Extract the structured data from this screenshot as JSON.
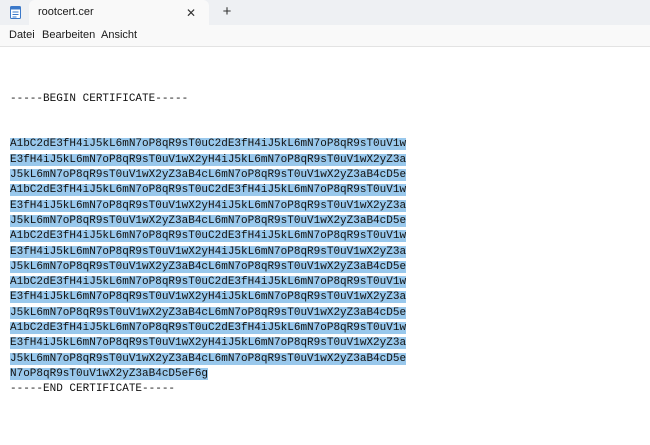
{
  "window": {
    "tab_title": "rootcert.cer",
    "close_glyph": "✕",
    "new_tab_glyph": "+"
  },
  "menu": {
    "file": "Datei",
    "edit": "Bearbeiten",
    "view": "Ansicht"
  },
  "document": {
    "begin_line": "-----BEGIN CERTIFICATE-----",
    "body_lines": [
      "A1bC2dE3fH4iJ5kL6mN7oP8qR9sT0uC2dE3fH4iJ5kL6mN7oP8qR9sT0uV1w",
      "E3fH4iJ5kL6mN7oP8qR9sT0uV1wX2yH4iJ5kL6mN7oP8qR9sT0uV1wX2yZ3a",
      "J5kL6mN7oP8qR9sT0uV1wX2yZ3aB4cL6mN7oP8qR9sT0uV1wX2yZ3aB4cD5e",
      "A1bC2dE3fH4iJ5kL6mN7oP8qR9sT0uC2dE3fH4iJ5kL6mN7oP8qR9sT0uV1w",
      "E3fH4iJ5kL6mN7oP8qR9sT0uV1wX2yH4iJ5kL6mN7oP8qR9sT0uV1wX2yZ3a",
      "J5kL6mN7oP8qR9sT0uV1wX2yZ3aB4cL6mN7oP8qR9sT0uV1wX2yZ3aB4cD5e",
      "A1bC2dE3fH4iJ5kL6mN7oP8qR9sT0uC2dE3fH4iJ5kL6mN7oP8qR9sT0uV1w",
      "E3fH4iJ5kL6mN7oP8qR9sT0uV1wX2yH4iJ5kL6mN7oP8qR9sT0uV1wX2yZ3a",
      "J5kL6mN7oP8qR9sT0uV1wX2yZ3aB4cL6mN7oP8qR9sT0uV1wX2yZ3aB4cD5e",
      "A1bC2dE3fH4iJ5kL6mN7oP8qR9sT0uC2dE3fH4iJ5kL6mN7oP8qR9sT0uV1w",
      "E3fH4iJ5kL6mN7oP8qR9sT0uV1wX2yH4iJ5kL6mN7oP8qR9sT0uV1wX2yZ3a",
      "J5kL6mN7oP8qR9sT0uV1wX2yZ3aB4cL6mN7oP8qR9sT0uV1wX2yZ3aB4cD5e",
      "A1bC2dE3fH4iJ5kL6mN7oP8qR9sT0uC2dE3fH4iJ5kL6mN7oP8qR9sT0uV1w",
      "E3fH4iJ5kL6mN7oP8qR9sT0uV1wX2yH4iJ5kL6mN7oP8qR9sT0uV1wX2yZ3a",
      "J5kL6mN7oP8qR9sT0uV1wX2yZ3aB4cL6mN7oP8qR9sT0uV1wX2yZ3aB4cD5e",
      "N7oP8qR9sT0uV1wX2yZ3aB4cD5eF6g"
    ],
    "end_line": "-----END CERTIFICATE-----"
  },
  "icons": {
    "app": "notepad-icon",
    "close": "close-icon",
    "new_tab": "plus-icon"
  },
  "colors": {
    "selection": "#99c8ec",
    "titlebar": "#eef0f3",
    "editor_bg": "#ffffff"
  }
}
